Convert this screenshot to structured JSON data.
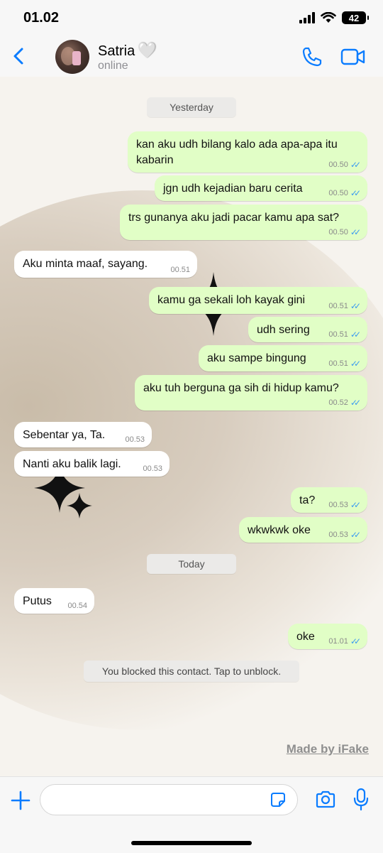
{
  "status_bar": {
    "time": "01.02",
    "battery": "42"
  },
  "header": {
    "name": "Satria",
    "heart": "🤍",
    "status": "online"
  },
  "dates": {
    "yesterday": "Yesterday",
    "today": "Today"
  },
  "messages": [
    {
      "dir": "out",
      "text": "kan aku udh bilang kalo ada apa-apa itu kabarin",
      "time": "00.50"
    },
    {
      "dir": "out",
      "text": "jgn udh kejadian baru cerita",
      "time": "00.50"
    },
    {
      "dir": "out",
      "text": "trs gunanya aku jadi pacar kamu apa sat?",
      "time": "00.50"
    },
    {
      "dir": "in",
      "text": "Aku minta maaf, sayang.",
      "time": "00.51"
    },
    {
      "dir": "out",
      "text": "kamu ga sekali loh kayak gini",
      "time": "00.51"
    },
    {
      "dir": "out",
      "text": "udh sering",
      "time": "00.51"
    },
    {
      "dir": "out",
      "text": "aku sampe bingung",
      "time": "00.51"
    },
    {
      "dir": "out",
      "text": "aku tuh berguna ga sih di hidup kamu?",
      "time": "00.52"
    },
    {
      "dir": "in",
      "text": "Sebentar ya, Ta.",
      "time": "00.53"
    },
    {
      "dir": "in",
      "text": "Nanti aku balik lagi.",
      "time": "00.53"
    },
    {
      "dir": "out",
      "text": "ta?",
      "time": "00.53"
    },
    {
      "dir": "out",
      "text": "wkwkwk oke",
      "time": "00.53"
    },
    {
      "dir": "in",
      "text": "Putus",
      "time": "00.54"
    },
    {
      "dir": "out",
      "text": "oke",
      "time": "01.01"
    }
  ],
  "notice": "You blocked this contact. Tap to unblock.",
  "watermark": "Made by iFake",
  "colors": {
    "accent": "#0a7cff",
    "outgoing_bubble": "#e1fec6",
    "incoming_bubble": "#ffffff",
    "read_ticks": "#3b9bf0"
  },
  "icons": [
    "back-chevron-icon",
    "phone-icon",
    "video-camera-icon",
    "plus-icon",
    "sticker-icon",
    "camera-icon",
    "microphone-icon"
  ]
}
